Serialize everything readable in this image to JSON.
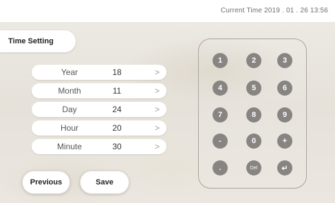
{
  "header": {
    "current_time": "Current Time  2019 . 01 . 26  13:56"
  },
  "panel": {
    "title": "Time Setting"
  },
  "fields": [
    {
      "label": "Year",
      "value": "18",
      "arrow": ">"
    },
    {
      "label": "Month",
      "value": "11",
      "arrow": ">"
    },
    {
      "label": "Day",
      "value": "24",
      "arrow": ">"
    },
    {
      "label": "Hour",
      "value": "20",
      "arrow": ">"
    },
    {
      "label": "Minute",
      "value": "30",
      "arrow": ">"
    }
  ],
  "buttons": {
    "previous": "Previous",
    "save": "Save"
  },
  "keypad": {
    "keys": [
      "1",
      "2",
      "3",
      "4",
      "5",
      "6",
      "7",
      "8",
      "9",
      "-",
      "0",
      "+",
      ".",
      "Del",
      "↵"
    ]
  },
  "colors": {
    "key_fill": "#878481",
    "keypad_border": "#a8a39b",
    "button_fill": "#ffffff"
  }
}
